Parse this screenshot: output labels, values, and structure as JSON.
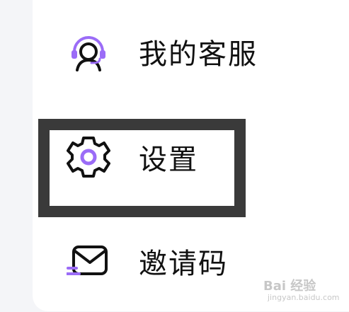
{
  "menu": {
    "items": [
      {
        "label": "我的客服",
        "icon": "customer-service-headset-icon"
      },
      {
        "label": "设置",
        "icon": "gear-icon"
      },
      {
        "label": "邀请码",
        "icon": "envelope-icon"
      }
    ]
  },
  "highlight": {
    "target": "设置"
  },
  "watermark": {
    "brand": "Bai 经验",
    "url": "jingyan.baidu.com"
  },
  "colors": {
    "accent": "#9b6cf7",
    "text": "#111111",
    "highlight_border": "#3a3a3a",
    "background": "#f4f5f8",
    "panel": "#ffffff"
  }
}
